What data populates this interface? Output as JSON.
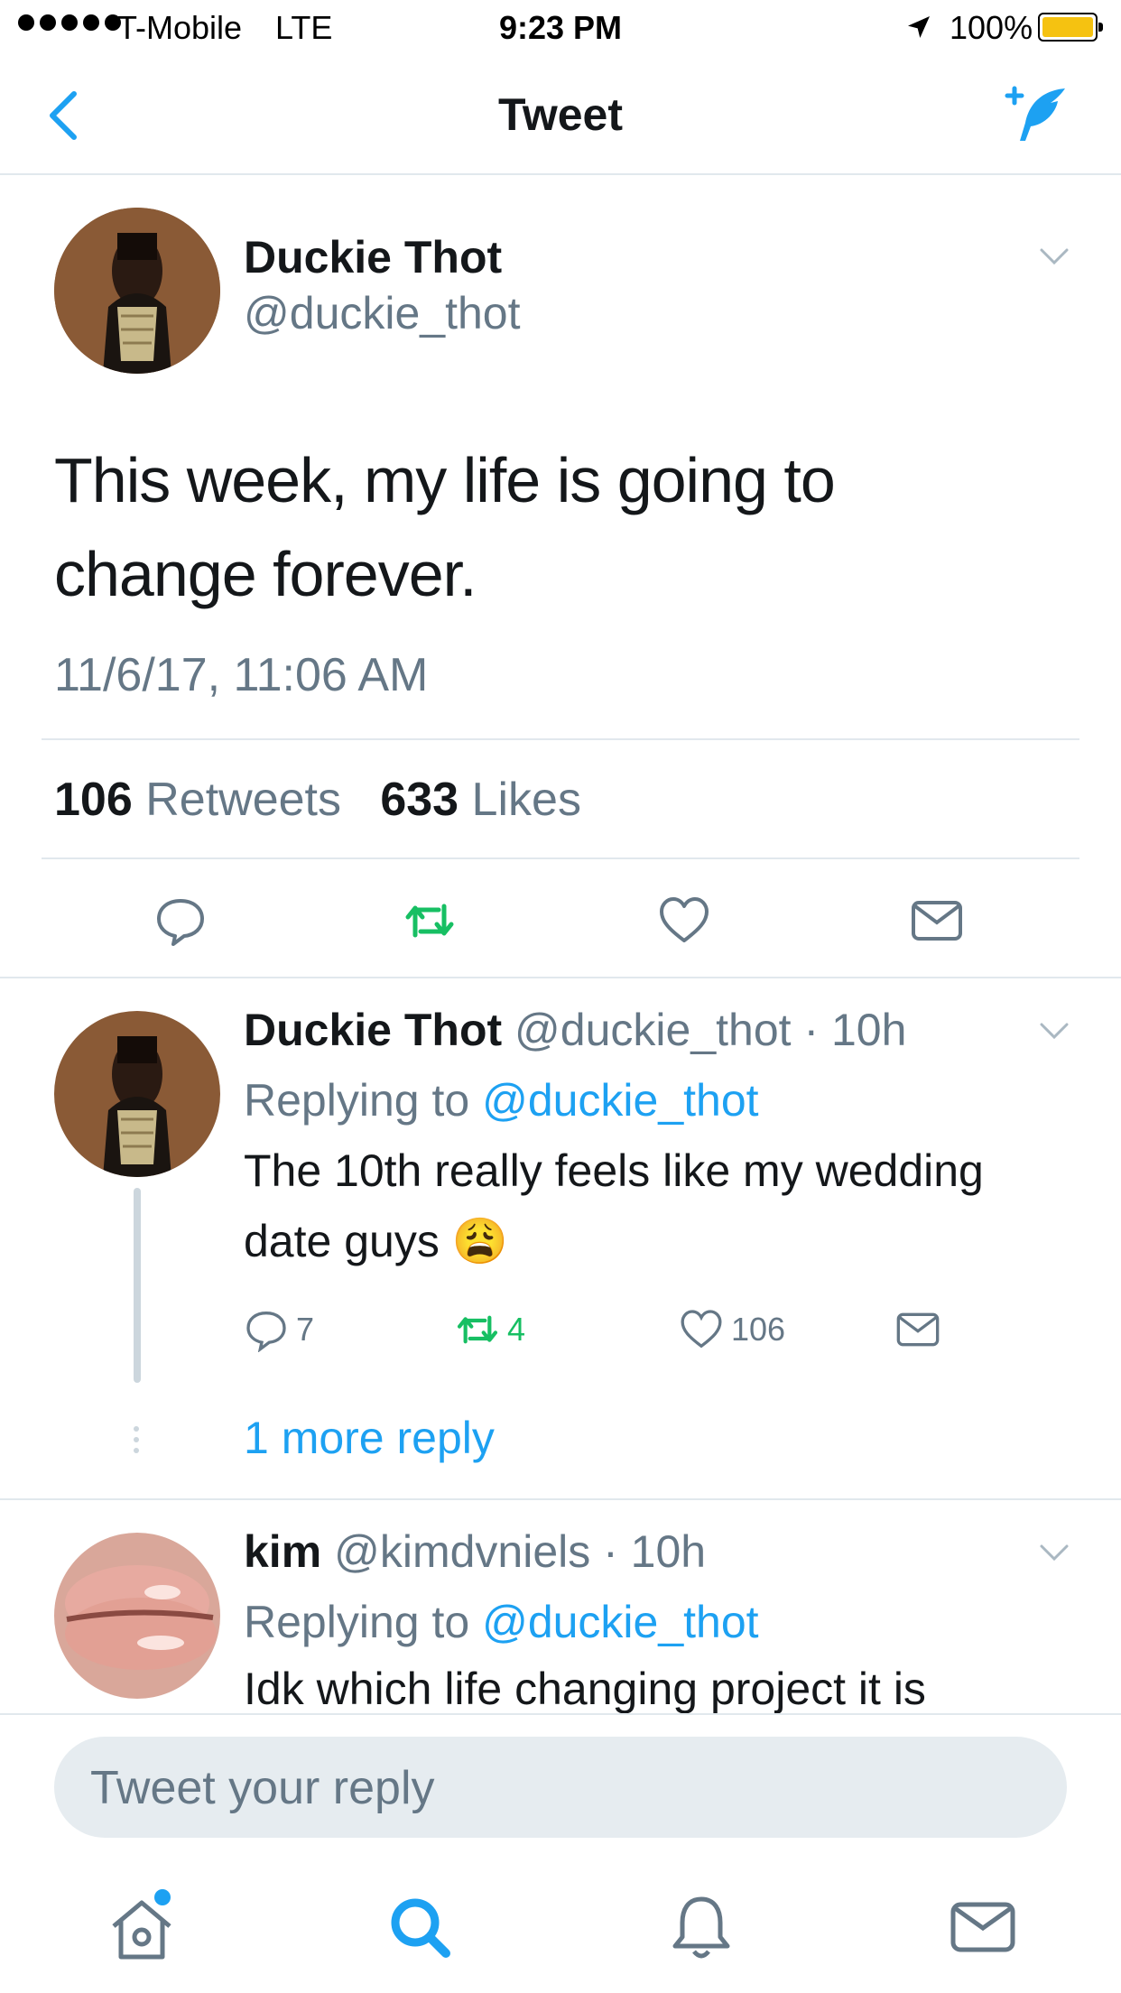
{
  "status_bar": {
    "carrier": "T-Mobile",
    "network": "LTE",
    "time": "9:23 PM",
    "battery": "100%"
  },
  "nav": {
    "title": "Tweet",
    "icons": [
      "back-icon",
      "compose-tweet-icon"
    ]
  },
  "main_tweet": {
    "name": "Duckie Thot",
    "handle": "@duckie_thot",
    "text": "This week, my life is going to change forever.",
    "timestamp": "11/6/17, 11:06 AM",
    "retweets_count": "106",
    "retweets_label": "Retweets",
    "likes_count": "633",
    "likes_label": "Likes"
  },
  "replies": [
    {
      "name": "Duckie Thot",
      "handle": "@duckie_thot",
      "age": "10h",
      "replying_prefix": "Replying to",
      "replying_to": "@duckie_thot",
      "text": "The 10th really feels like my wedding date guys 😩",
      "reply_count": "7",
      "retweet_count": "4",
      "like_count": "106",
      "more_replies": "1 more reply"
    },
    {
      "name": "kim",
      "handle": "@kimdvniels",
      "age": "10h",
      "replying_prefix": "Replying to",
      "replying_to": "@duckie_thot",
      "text": "Idk which life changing project it is"
    }
  ],
  "composer": {
    "placeholder": "Tweet your reply"
  },
  "tab_bar": [
    "home-icon",
    "search-icon",
    "notifications-icon",
    "messages-icon"
  ],
  "colors": {
    "accent": "#1da1f2",
    "retweet": "#17bf63",
    "muted": "#657786",
    "divider": "#e1e8ed"
  }
}
